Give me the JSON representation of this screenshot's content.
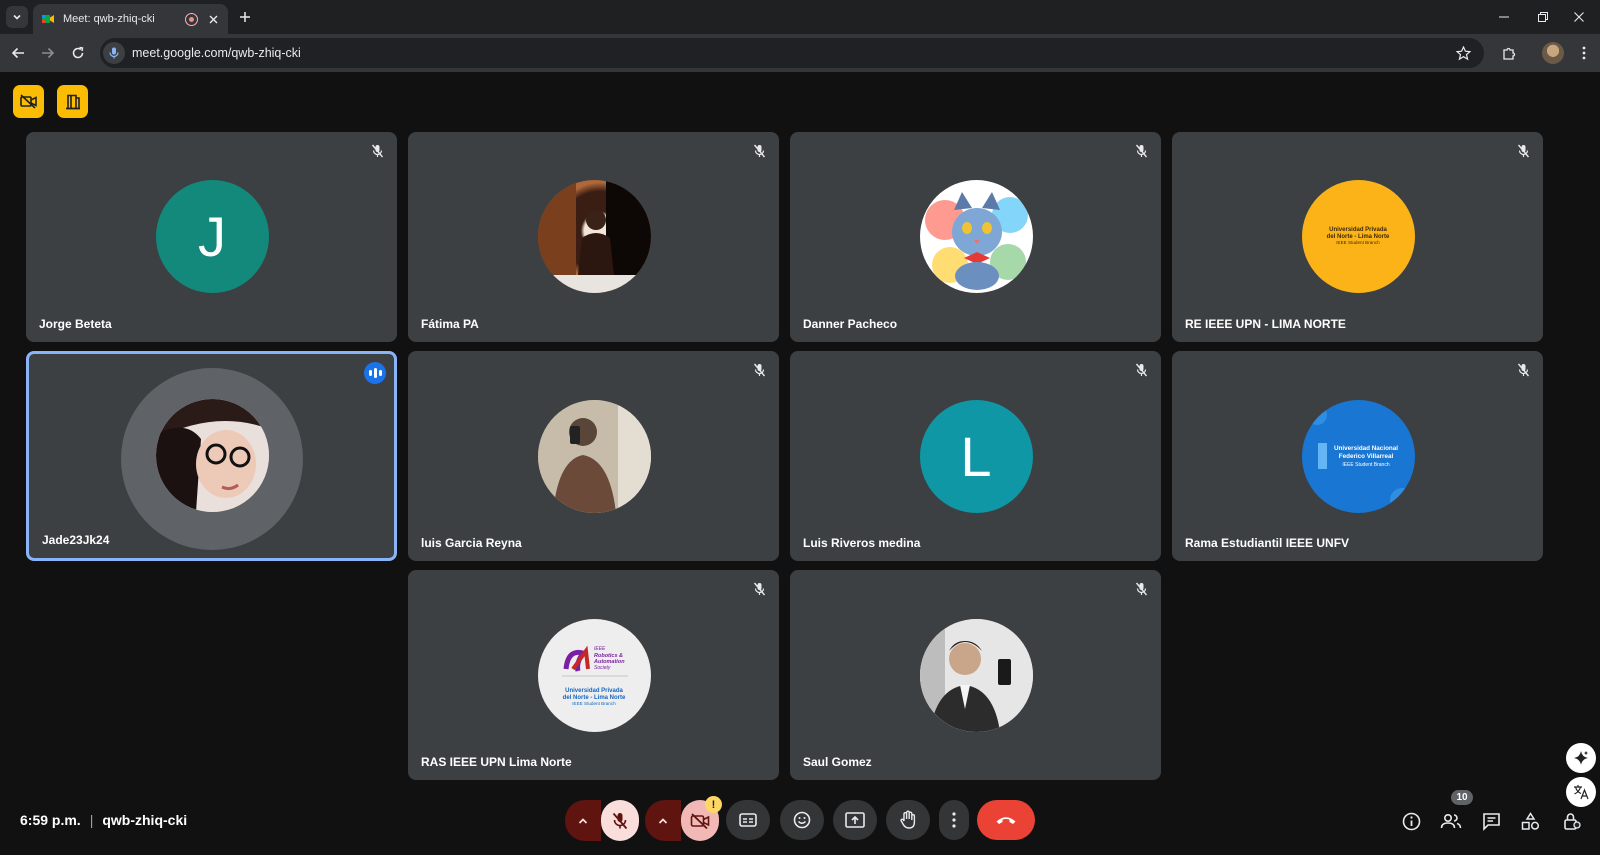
{
  "browser": {
    "tab_title": "Meet: qwb-zhiq-cki",
    "url": "meet.google.com/qwb-zhiq-cki"
  },
  "meeting": {
    "time": "6:59 p.m.",
    "separator": "|",
    "code": "qwb-zhiq-cki",
    "participant_count": "10",
    "warning_badge": "!"
  },
  "participants": [
    {
      "name": "Jorge Beteta",
      "avatar": "letter",
      "letter": "J",
      "color": "#12897a",
      "mic": "muted"
    },
    {
      "name": "Fátima PA",
      "avatar": "photo",
      "mic": "muted"
    },
    {
      "name": "Danner Pacheco",
      "avatar": "cat-illustration",
      "mic": "muted"
    },
    {
      "name": "RE IEEE UPN - LIMA NORTE",
      "avatar": "logo",
      "color": "#fbb318",
      "logo_text": [
        "Universidad Privada",
        "del Norte - Lima Norte",
        "IEEE Student Branch"
      ],
      "mic": "muted"
    },
    {
      "name": "Jade23Jk24",
      "avatar": "photo",
      "mic": "speaking",
      "active": true
    },
    {
      "name": "luis Garcia Reyna",
      "avatar": "photo",
      "mic": "muted"
    },
    {
      "name": "Luis Riveros medina",
      "avatar": "letter",
      "letter": "L",
      "color": "#0f97a6",
      "mic": "muted"
    },
    {
      "name": "Rama Estudiantil IEEE UNFV",
      "avatar": "logo",
      "color": "#1976d2",
      "logo_text": [
        "Universidad Nacional",
        "Federico Villarreal",
        "IEEE Student Branch"
      ],
      "mic": "muted"
    },
    {
      "name": "RAS IEEE UPN Lima Norte",
      "avatar": "logo",
      "color": "#eeeeee",
      "logo_text": [
        "IEEE",
        "Robotics &",
        "Automation",
        "Society",
        "Universidad Privada",
        "del Norte - Lima Norte",
        "IEEE Student Branch"
      ],
      "mic": "muted"
    },
    {
      "name": "Saul Gomez",
      "avatar": "photo",
      "mic": "muted"
    }
  ],
  "colors": {
    "accent": "#8ab4f8",
    "end_call": "#ea4335",
    "mic_off_bg": "#f9dedc",
    "mic_off_dark": "#601410",
    "chip": "#fbbc04"
  },
  "icons": {
    "top_chips": [
      "camera-off-chip-icon",
      "companion-door-icon"
    ],
    "controls": [
      "mic-options-chevron-icon",
      "mic-off-icon",
      "camera-options-chevron-icon",
      "camera-off-icon",
      "captions-icon",
      "emoji-icon",
      "present-screen-icon",
      "raise-hand-icon",
      "more-options-icon",
      "end-call-icon"
    ],
    "right": [
      "info-icon",
      "people-icon",
      "chat-icon",
      "activities-icon",
      "host-controls-icon"
    ]
  }
}
